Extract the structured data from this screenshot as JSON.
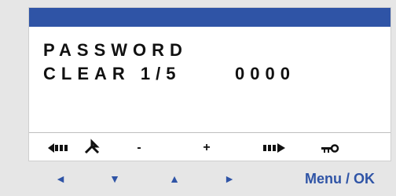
{
  "screen": {
    "line1": "PASSWORD",
    "line2": "CLEAR 1/5",
    "value": "0000"
  },
  "softkeys": {
    "left_label": "(",
    "left_icon": "left-arrow-icon",
    "move_icon": "move-icon",
    "minus": "-",
    "plus": "+",
    "right_icon": "right-arrow-icon",
    "key_icon": "key-icon"
  },
  "buttons": {
    "left": "◄",
    "down": "▼",
    "up": "▲",
    "right": "►",
    "menu_ok": "Menu / OK"
  },
  "colors": {
    "accent": "#2f54a6",
    "screen_bg": "#ffffff",
    "device_bg": "#e6e6e6"
  }
}
